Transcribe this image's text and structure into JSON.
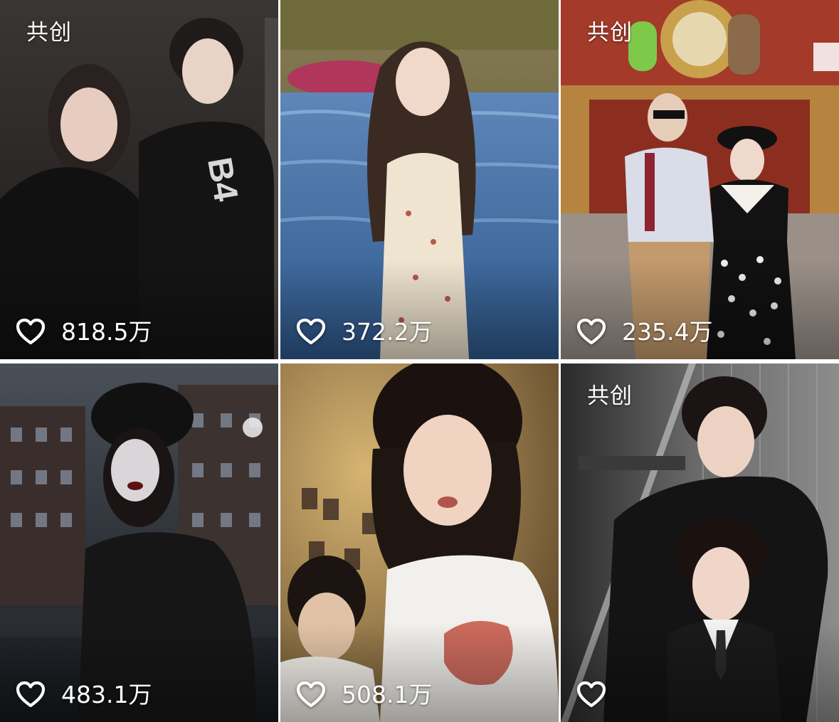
{
  "grid": {
    "items": [
      {
        "badge": "共创",
        "likes": "818.5万",
        "theme": "dark-studio"
      },
      {
        "badge": "",
        "likes": "372.2万",
        "theme": "pool-evening"
      },
      {
        "badge": "共创",
        "likes": "235.4万",
        "theme": "festival-street"
      },
      {
        "badge": "",
        "likes": "483.1万",
        "theme": "night-city"
      },
      {
        "badge": "",
        "likes": "508.1万",
        "theme": "warm-room"
      },
      {
        "badge": "共创",
        "likes": "",
        "theme": "grey-studio"
      }
    ]
  },
  "icons": {
    "like": "heart-outline-icon"
  },
  "colors": {
    "overlay_text": "#ffffff",
    "separator": "#ffffff"
  }
}
